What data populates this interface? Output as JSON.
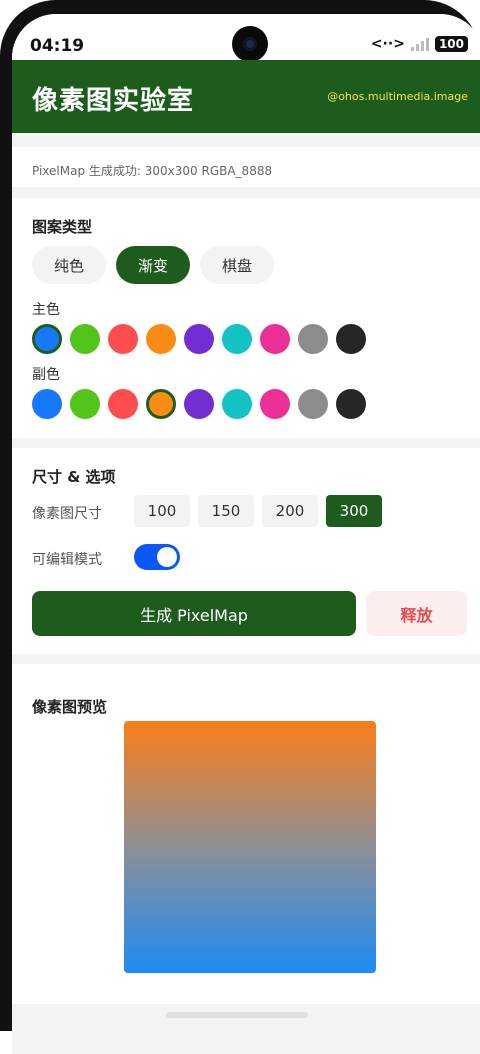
{
  "status_bar": {
    "time": "04:19",
    "network": "<··>",
    "battery": "100"
  },
  "header": {
    "title": "像素图实验室",
    "subtitle": "@ohos.multimedia.image"
  },
  "status_message": "PixelMap 生成成功: 300x300 RGBA_8888",
  "pattern": {
    "title": "图案类型",
    "types": [
      {
        "label": "纯色",
        "active": false
      },
      {
        "label": "渐变",
        "active": true
      },
      {
        "label": "棋盘",
        "active": false
      }
    ],
    "primary_label": "主色",
    "secondary_label": "副色",
    "palette": [
      "#1677ff",
      "#52c41a",
      "#ff4d4f",
      "#fa8c16",
      "#722ed1",
      "#13c2c2",
      "#eb2f96",
      "#8c8c8c",
      "#262626"
    ],
    "primary_selected_index": 0,
    "secondary_selected_index": 3
  },
  "options": {
    "title": "尺寸 & 选项",
    "size_label": "像素图尺寸",
    "sizes": [
      {
        "label": "100",
        "active": false
      },
      {
        "label": "150",
        "active": false
      },
      {
        "label": "200",
        "active": false
      },
      {
        "label": "300",
        "active": true
      }
    ],
    "editable_label": "可编辑模式",
    "editable_on": true,
    "generate_label": "生成 PixelMap",
    "release_label": "释放"
  },
  "preview": {
    "title": "像素图预览",
    "gradient_start": "#fa7d19",
    "gradient_end": "#1c8cf4"
  },
  "colors": {
    "brand_green": "#1e5c1e",
    "subtitle_yellow": "#f1e64b",
    "toggle_blue": "#0a59f7",
    "release_red": "#e84b4b"
  }
}
